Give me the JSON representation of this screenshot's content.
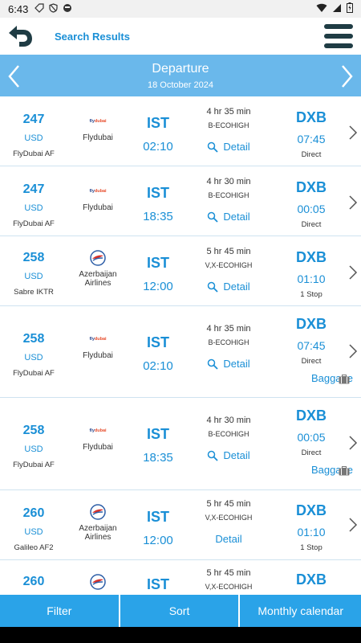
{
  "statusbar": {
    "time": "6:43"
  },
  "header": {
    "title": "Search Results"
  },
  "datebar": {
    "direction": "Departure",
    "date": "18 October 2024"
  },
  "flights": [
    {
      "price": "247",
      "currency": "USD",
      "source": "FlyDubai AF",
      "airline": "Flydubai",
      "logo": "flydubai-logo",
      "origin": "IST",
      "dep_time": "02:10",
      "duration": "4 hr 35 min",
      "fare_class": "B-ECOHIGH",
      "detail": "Detail",
      "dest": "DXB",
      "arr_time": "07:45",
      "stops": "Direct",
      "baggage": ""
    },
    {
      "price": "247",
      "currency": "USD",
      "source": "FlyDubai AF",
      "airline": "Flydubai",
      "logo": "flydubai-logo",
      "origin": "IST",
      "dep_time": "18:35",
      "duration": "4 hr 30 min",
      "fare_class": "B-ECOHIGH",
      "detail": "Detail",
      "dest": "DXB",
      "arr_time": "00:05",
      "stops": "Direct",
      "baggage": ""
    },
    {
      "price": "258",
      "currency": "USD",
      "source": "Sabre IKTR",
      "airline": "Azerbaijan Airlines",
      "logo": "azal-logo",
      "origin": "IST",
      "dep_time": "12:00",
      "duration": "5 hr 45 min",
      "fare_class": "V,X-ECOHIGH",
      "detail": "Detail",
      "dest": "DXB",
      "arr_time": "01:10",
      "stops": "1 Stop",
      "baggage": ""
    },
    {
      "price": "258",
      "currency": "USD",
      "source": "FlyDubai AF",
      "airline": "Flydubai",
      "logo": "flydubai-logo",
      "origin": "IST",
      "dep_time": "02:10",
      "duration": "4 hr 35 min",
      "fare_class": "B-ECOHIGH",
      "detail": "Detail",
      "dest": "DXB",
      "arr_time": "07:45",
      "stops": "Direct",
      "baggage": "Baggage"
    },
    {
      "price": "258",
      "currency": "USD",
      "source": "FlyDubai AF",
      "airline": "Flydubai",
      "logo": "flydubai-logo",
      "origin": "IST",
      "dep_time": "18:35",
      "duration": "4 hr 30 min",
      "fare_class": "B-ECOHIGH",
      "detail": "Detail",
      "dest": "DXB",
      "arr_time": "00:05",
      "stops": "Direct",
      "baggage": "Baggage"
    },
    {
      "price": "260",
      "currency": "USD",
      "source": "Galileo AF2",
      "airline": "Azerbaijan Airlines",
      "logo": "azal-logo",
      "origin": "IST",
      "dep_time": "12:00",
      "duration": "5 hr 45 min",
      "fare_class": "V,X-ECOHIGH",
      "detail": "Detail",
      "dest": "DXB",
      "arr_time": "01:10",
      "stops": "1 Stop",
      "baggage": ""
    },
    {
      "price": "260",
      "currency": "",
      "source": "",
      "airline": "",
      "logo": "azal-logo",
      "origin": "IST",
      "dep_time": "",
      "duration": "5 hr 45 min",
      "fare_class": "V,X-ECOHIGH",
      "detail": "",
      "dest": "DXB",
      "arr_time": "",
      "stops": "",
      "baggage": ""
    }
  ],
  "bottom_tabs": [
    "Filter",
    "Sort",
    "Monthly calendar"
  ],
  "colors": {
    "accent": "#1a8fd6",
    "datebar": "#6ab8eb",
    "tab": "#2aa3e8",
    "menu": "#1f3c44"
  }
}
